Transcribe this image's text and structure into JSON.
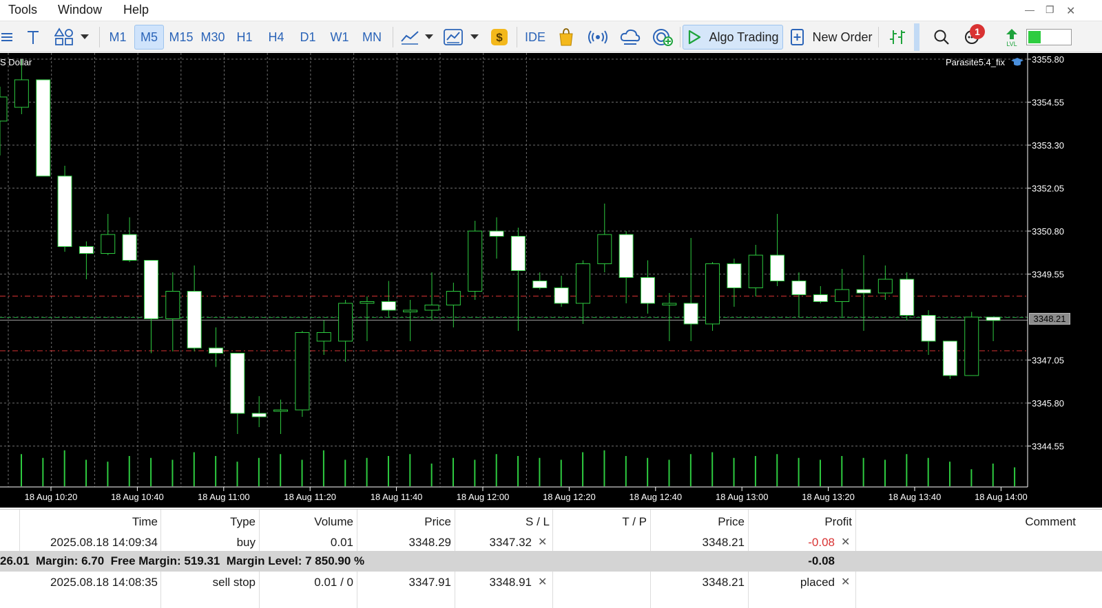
{
  "menu": {
    "items": [
      "Tools",
      "Window",
      "Help"
    ]
  },
  "toolbar": {
    "timeframes": [
      "M1",
      "M5",
      "M15",
      "M30",
      "H1",
      "H4",
      "D1",
      "W1",
      "MN"
    ],
    "active_timeframe": "M5",
    "ide_label": "IDE",
    "algo_trading_label": "Algo Trading",
    "new_order_label": "New Order",
    "notifications_count": "1"
  },
  "chart": {
    "symbol_label": "S Dollar",
    "expert_label": "Parasite5.4_fix",
    "current_price": "3348.21",
    "y_ticks": [
      "3355.80",
      "3354.55",
      "3353.30",
      "3352.05",
      "3350.80",
      "3349.55",
      "3347.05",
      "3345.80",
      "3344.55"
    ],
    "x_ticks": [
      "18 Aug 10:20",
      "18 Aug 10:40",
      "18 Aug 11:00",
      "18 Aug 11:20",
      "18 Aug 11:40",
      "18 Aug 12:00",
      "18 Aug 12:20",
      "18 Aug 12:40",
      "18 Aug 13:00",
      "18 Aug 13:20",
      "18 Aug 13:40",
      "18 Aug 14:00"
    ],
    "candles": [
      {
        "o": 3354.0,
        "h": 3355.0,
        "l": 3353.0,
        "c": 3354.7
      },
      {
        "o": 3354.4,
        "h": 3355.8,
        "l": 3354.2,
        "c": 3355.2
      },
      {
        "o": 3355.2,
        "h": 3355.2,
        "l": 3352.4,
        "c": 3352.4
      },
      {
        "o": 3352.4,
        "h": 3352.7,
        "l": 3350.2,
        "c": 3350.35
      },
      {
        "o": 3350.35,
        "h": 3350.5,
        "l": 3349.4,
        "c": 3350.15
      },
      {
        "o": 3350.15,
        "h": 3351.3,
        "l": 3350.1,
        "c": 3350.7
      },
      {
        "o": 3350.7,
        "h": 3351.2,
        "l": 3349.9,
        "c": 3349.95
      },
      {
        "o": 3349.95,
        "h": 3349.95,
        "l": 3347.25,
        "c": 3348.25
      },
      {
        "o": 3348.25,
        "h": 3349.6,
        "l": 3347.3,
        "c": 3349.05
      },
      {
        "o": 3349.05,
        "h": 3349.8,
        "l": 3347.3,
        "c": 3347.4
      },
      {
        "o": 3347.4,
        "h": 3348.0,
        "l": 3346.85,
        "c": 3347.25
      },
      {
        "o": 3347.25,
        "h": 3347.25,
        "l": 3344.9,
        "c": 3345.5
      },
      {
        "o": 3345.5,
        "h": 3346.0,
        "l": 3345.1,
        "c": 3345.4
      },
      {
        "o": 3345.6,
        "h": 3345.9,
        "l": 3344.9,
        "c": 3345.6
      },
      {
        "o": 3345.6,
        "h": 3347.9,
        "l": 3345.4,
        "c": 3347.85
      },
      {
        "o": 3347.6,
        "h": 3348.2,
        "l": 3347.2,
        "c": 3347.85
      },
      {
        "o": 3347.6,
        "h": 3348.8,
        "l": 3347.0,
        "c": 3348.7
      },
      {
        "o": 3348.7,
        "h": 3348.9,
        "l": 3347.6,
        "c": 3348.75
      },
      {
        "o": 3348.75,
        "h": 3349.35,
        "l": 3348.3,
        "c": 3348.5
      },
      {
        "o": 3348.45,
        "h": 3348.8,
        "l": 3347.6,
        "c": 3348.5
      },
      {
        "o": 3348.5,
        "h": 3349.6,
        "l": 3348.2,
        "c": 3348.65
      },
      {
        "o": 3348.65,
        "h": 3349.3,
        "l": 3348.0,
        "c": 3349.05
      },
      {
        "o": 3349.05,
        "h": 3351.1,
        "l": 3348.8,
        "c": 3350.8
      },
      {
        "o": 3350.8,
        "h": 3351.2,
        "l": 3350.0,
        "c": 3350.65
      },
      {
        "o": 3350.65,
        "h": 3350.9,
        "l": 3347.9,
        "c": 3349.65
      },
      {
        "o": 3349.35,
        "h": 3349.6,
        "l": 3349.1,
        "c": 3349.15
      },
      {
        "o": 3349.15,
        "h": 3349.5,
        "l": 3348.6,
        "c": 3348.7
      },
      {
        "o": 3348.7,
        "h": 3349.95,
        "l": 3348.1,
        "c": 3349.85
      },
      {
        "o": 3349.85,
        "h": 3351.6,
        "l": 3349.6,
        "c": 3350.7
      },
      {
        "o": 3350.7,
        "h": 3350.8,
        "l": 3348.7,
        "c": 3349.45
      },
      {
        "o": 3349.45,
        "h": 3349.95,
        "l": 3348.4,
        "c": 3348.7
      },
      {
        "o": 3348.65,
        "h": 3349.0,
        "l": 3347.6,
        "c": 3348.7
      },
      {
        "o": 3348.7,
        "h": 3350.6,
        "l": 3347.6,
        "c": 3348.1
      },
      {
        "o": 3348.1,
        "h": 3349.9,
        "l": 3347.9,
        "c": 3349.85
      },
      {
        "o": 3349.85,
        "h": 3350.0,
        "l": 3348.6,
        "c": 3349.15
      },
      {
        "o": 3349.15,
        "h": 3350.4,
        "l": 3348.9,
        "c": 3350.1
      },
      {
        "o": 3350.1,
        "h": 3351.3,
        "l": 3349.2,
        "c": 3349.35
      },
      {
        "o": 3349.35,
        "h": 3349.6,
        "l": 3348.3,
        "c": 3348.95
      },
      {
        "o": 3348.95,
        "h": 3349.2,
        "l": 3348.7,
        "c": 3348.75
      },
      {
        "o": 3348.75,
        "h": 3349.7,
        "l": 3348.3,
        "c": 3349.1
      },
      {
        "o": 3349.1,
        "h": 3350.1,
        "l": 3347.9,
        "c": 3349.0
      },
      {
        "o": 3349.0,
        "h": 3349.8,
        "l": 3348.8,
        "c": 3349.4
      },
      {
        "o": 3349.4,
        "h": 3349.6,
        "l": 3348.2,
        "c": 3348.35
      },
      {
        "o": 3348.35,
        "h": 3348.5,
        "l": 3347.2,
        "c": 3347.6
      },
      {
        "o": 3347.6,
        "h": 3347.6,
        "l": 3346.5,
        "c": 3346.6
      },
      {
        "o": 3346.6,
        "h": 3348.45,
        "l": 3346.6,
        "c": 3348.3
      },
      {
        "o": 3348.3,
        "h": 3348.3,
        "l": 3347.6,
        "c": 3348.2
      }
    ],
    "volume_heights": [
      0.85,
      0.75,
      0.95,
      0.7,
      0.65,
      0.8,
      0.75,
      0.7,
      0.9,
      0.8,
      0.65,
      0.75,
      0.85,
      0.7,
      0.95,
      0.7,
      0.75,
      0.8,
      0.85,
      0.6,
      0.75,
      0.7,
      0.85,
      0.8,
      0.75,
      0.7,
      0.9,
      0.95,
      0.8,
      0.75,
      0.7,
      0.85,
      0.9,
      0.75,
      0.8,
      0.85,
      0.75,
      0.7,
      0.8,
      0.75,
      0.7,
      0.85,
      0.75,
      0.65,
      0.45,
      0.6,
      0.5
    ]
  },
  "trade": {
    "headers": [
      "Time",
      "Type",
      "Volume",
      "Price",
      "S / L",
      "T / P",
      "Price",
      "Profit",
      "Comment"
    ],
    "rows": [
      {
        "time": "2025.08.18 14:09:34",
        "type": "buy",
        "volume": "0.01",
        "price": "3348.29",
        "sl": "3347.32",
        "tp": "",
        "price2": "3348.21",
        "profit": "-0.08"
      },
      {
        "time": "2025.08.18 14:08:35",
        "type": "sell stop",
        "volume": "0.01 / 0",
        "price": "3347.91",
        "sl": "3348.91",
        "tp": "",
        "price2": "3348.21",
        "profit": "placed"
      }
    ],
    "summary": {
      "text": "26.01  Margin: 6.70  Free Margin: 519.31  Margin Level: 7 850.90 %",
      "profit": "-0.08"
    },
    "colors": {
      "negative": "#d93232"
    }
  }
}
